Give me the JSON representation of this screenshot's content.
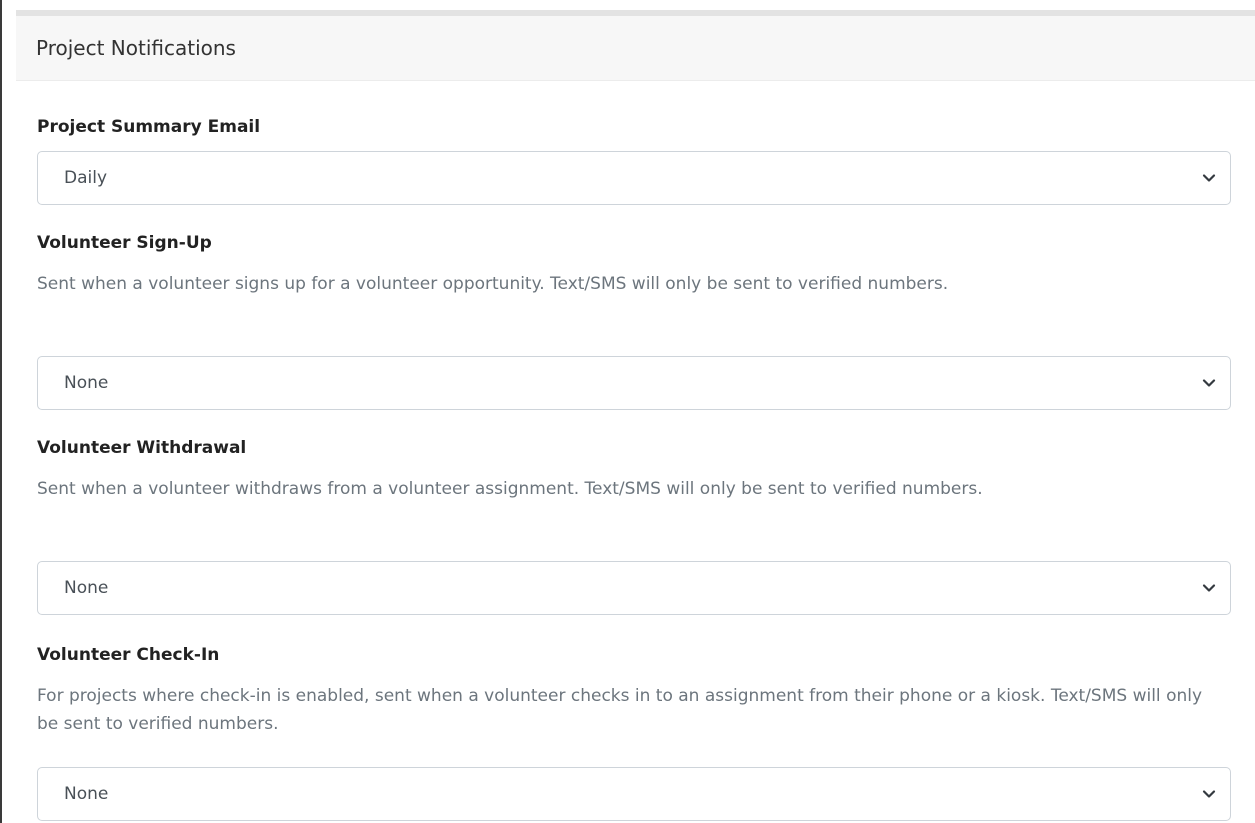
{
  "card": {
    "title": "Project Notifications"
  },
  "fields": [
    {
      "label": "Project Summary Email",
      "help": "",
      "value": "Daily"
    },
    {
      "label": "Volunteer Sign-Up",
      "help": "Sent when a volunteer signs up for a volunteer opportunity. Text/SMS will only be sent to verified numbers.",
      "value": "None"
    },
    {
      "label": "Volunteer Withdrawal",
      "help": "Sent when a volunteer withdraws from a volunteer assignment. Text/SMS will only be sent to verified numbers.",
      "value": "None"
    },
    {
      "label": "Volunteer Check-In",
      "help": "For projects where check-in is enabled, sent when a volunteer checks in to an assignment from their phone or a kiosk. Text/SMS will only be sent to verified numbers.",
      "value": "None"
    }
  ],
  "icons": {
    "select_arrow": "chevron-down-icon"
  }
}
